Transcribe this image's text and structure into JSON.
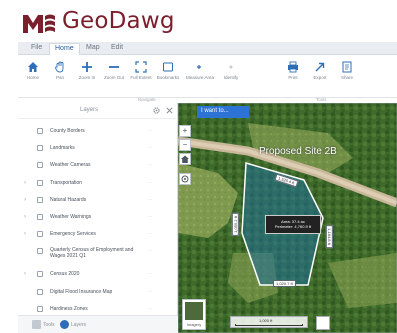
{
  "app": {
    "title": "GeoDawg"
  },
  "ribbon": {
    "tabs": [
      {
        "label": "File"
      },
      {
        "label": "Home",
        "active": true
      },
      {
        "label": "Map"
      },
      {
        "label": "Edit"
      }
    ],
    "tools": [
      {
        "label": "Home",
        "icon": "home-icon"
      },
      {
        "label": "Pan",
        "icon": "hand-icon"
      },
      {
        "label": "Zoom In",
        "icon": "zoom-in-icon"
      },
      {
        "label": "Zoom Out",
        "icon": "zoom-out-icon"
      },
      {
        "label": "Full Extent",
        "icon": "full-extent-icon"
      },
      {
        "label": "Bookmarks",
        "icon": "bookmark-icon"
      },
      {
        "label": "Measure Area",
        "icon": "measure-icon"
      },
      {
        "label": "Identify",
        "icon": "identify-icon"
      },
      {
        "label": "Print",
        "icon": "print-icon"
      },
      {
        "label": "Export",
        "icon": "export-icon"
      },
      {
        "label": "Share",
        "icon": "share-icon"
      }
    ],
    "groups": [
      {
        "label": "Navigate"
      },
      {
        "label": "Tools"
      }
    ]
  },
  "layers": {
    "title": "Layers",
    "items": [
      {
        "name": "County Borders",
        "expandable": false,
        "opts": "···"
      },
      {
        "name": "Landmarks",
        "expandable": false,
        "opts": "···"
      },
      {
        "name": "Weather Cameras",
        "expandable": false,
        "opts": "···"
      },
      {
        "name": "Transportation",
        "expandable": true,
        "opts": "···"
      },
      {
        "name": "Natural Hazards",
        "expandable": true,
        "opts": "···"
      },
      {
        "name": "Weather Warnings",
        "expandable": true,
        "opts": "···"
      },
      {
        "name": "Emergency Services",
        "expandable": true,
        "opts": "···"
      },
      {
        "name": "Quarterly Census of Employment and Wages 2021 Q1",
        "expandable": false,
        "opts": "···"
      },
      {
        "name": "Census 2020",
        "expandable": true,
        "opts": "···"
      },
      {
        "name": "Digital Flood Insurance Map",
        "expandable": false,
        "opts": "···"
      },
      {
        "name": "Hardiness Zones",
        "expandable": false,
        "opts": "···"
      }
    ]
  },
  "panel_tabs": [
    {
      "label": "Tools"
    },
    {
      "label": "Layers",
      "active": true
    }
  ],
  "map": {
    "search_label": "I want to...",
    "site_label": "Proposed Site 2B",
    "dimensions": {
      "top": "1,520.4 ft",
      "left": "1,055.2 ft",
      "right": "1,164.8 ft",
      "bottom": "1,020.7 ft"
    },
    "popup": {
      "line1": "Area: 37.4 ac",
      "line2": "Perimeter: 4,760.9 ft"
    },
    "basemap_label": "Imagery",
    "scale_label": "1,000 ft",
    "colors": {
      "polygon_fill": "#1f6f9a",
      "polygon_stroke": "#ffffff",
      "road": "#c9b79a",
      "vegetation": "#3f6a2b"
    }
  }
}
